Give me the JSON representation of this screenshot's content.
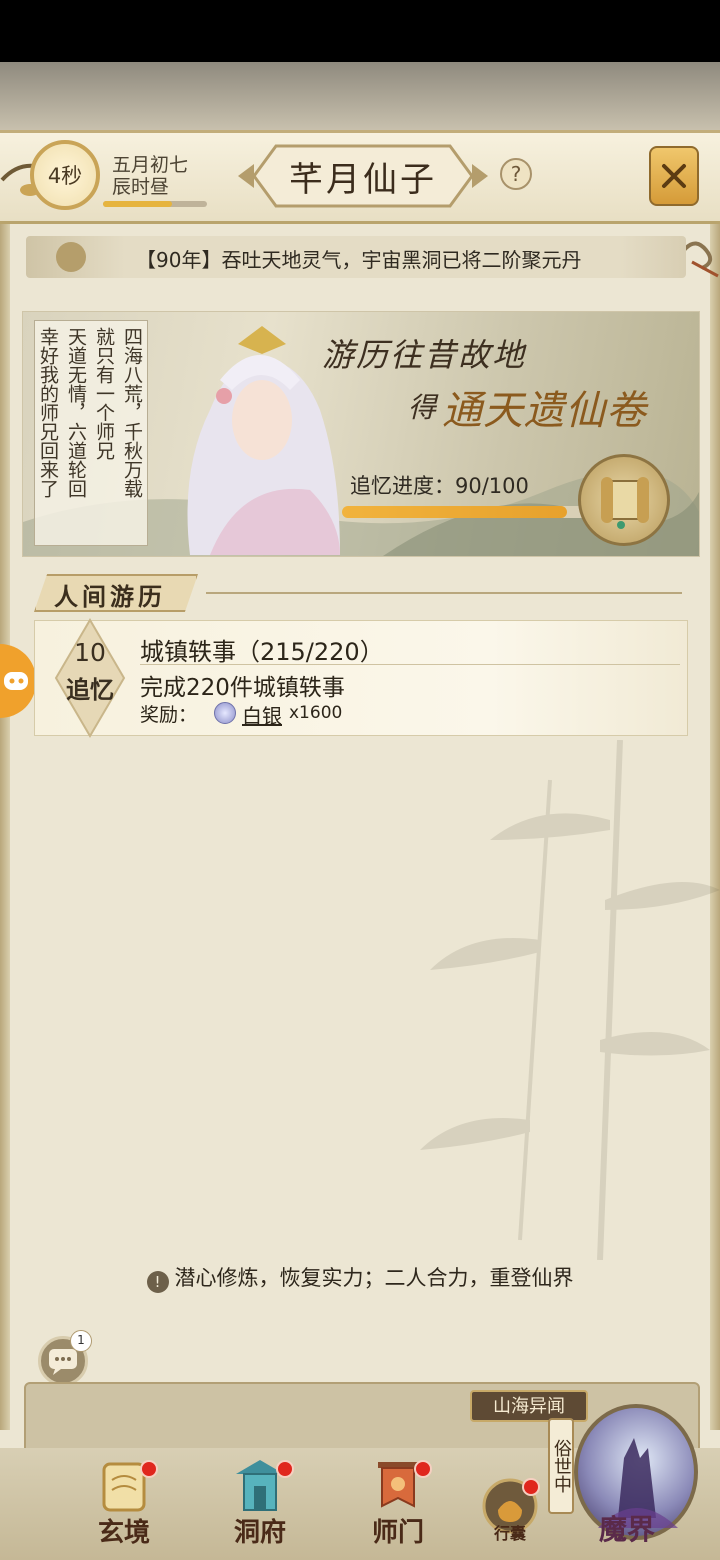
{
  "header": {
    "timer": "4秒",
    "date_line1": "五月初七",
    "date_line2": "辰时昼",
    "title": "芊月仙子",
    "help": "?"
  },
  "notice": {
    "text": "【90年】吞吐天地灵气，宇宙黑洞已将二阶聚元丹"
  },
  "banner": {
    "verse_columns": [
      "四海八荒，千秋万载",
      "就只有一个师兄",
      "天道无情，六道轮回",
      "幸好我的师兄回来了"
    ],
    "headline1": "游历往昔故地",
    "headline2_prefix": "得",
    "headline2_main": "通天遗仙卷",
    "progress_label": "追忆进度：90/100",
    "progress_current": 90,
    "progress_total": 100
  },
  "section": {
    "title": "人间游历"
  },
  "task": {
    "badge_number": "10",
    "badge_label": "追忆",
    "title": "城镇轶事（215/220）",
    "description": "完成220件城镇轶事",
    "reward_label": "奖励：",
    "reward_name": "白银",
    "reward_qty": "x1600"
  },
  "bottom_message": "潜心修炼，恢复实力；二人合力，重登仙界",
  "chat_badge": "1",
  "nav": {
    "shanhai": "山海异闻",
    "sushi": "俗世中",
    "items": [
      {
        "label": "玄境"
      },
      {
        "label": "洞府"
      },
      {
        "label": "师门"
      },
      {
        "label": "行囊"
      }
    ],
    "mojie": "魔界"
  },
  "colors": {
    "accent": "#e6a83a",
    "alert": "#e0261d",
    "text": "#2c2519"
  }
}
